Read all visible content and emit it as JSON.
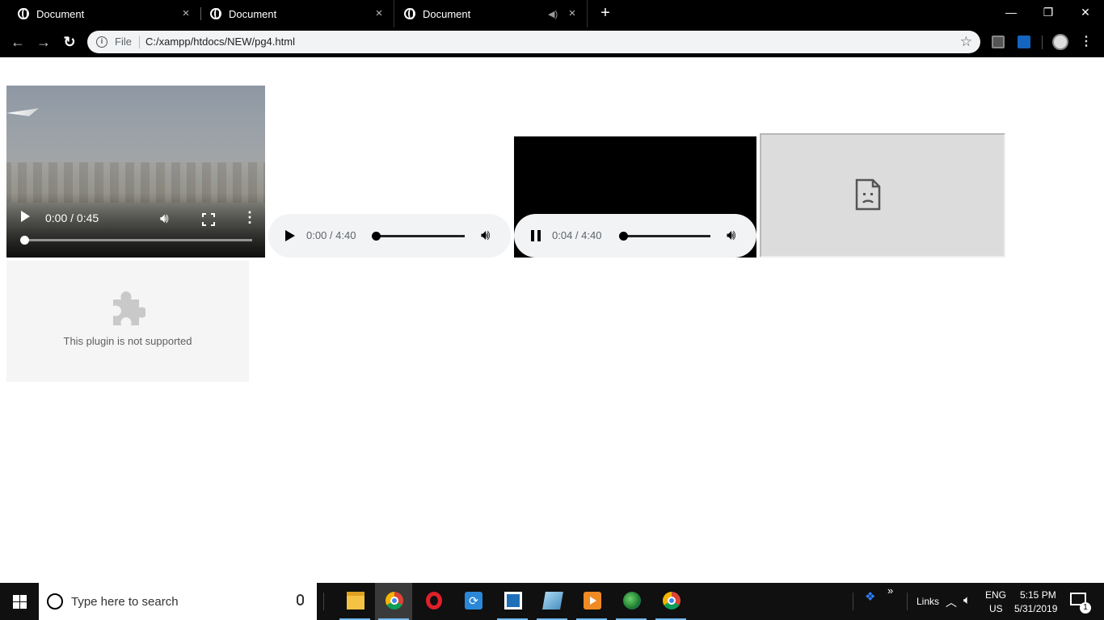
{
  "browser": {
    "tabs": [
      {
        "title": "Document",
        "active": false
      },
      {
        "title": "Document",
        "active": false
      },
      {
        "title": "Document",
        "active": true,
        "audio": true
      }
    ],
    "tab_close_glyph": "×",
    "new_tab_glyph": "+",
    "window_controls": {
      "minimize": "—",
      "restore": "❐",
      "close": "✕"
    },
    "nav": {
      "back": "←",
      "forward": "→",
      "reload": "↻"
    },
    "omnibox": {
      "scheme_label": "File",
      "url": "C:/xampp/htdocs/NEW/pg4.html",
      "star": "☆"
    }
  },
  "page": {
    "video": {
      "time": "0:00 / 0:45",
      "progress": 0.0,
      "playing": false
    },
    "audio_players": [
      {
        "time": "0:00 / 4:40",
        "playing": false,
        "progress": 0.0
      },
      {
        "time": "0:04 / 4:40",
        "playing": true,
        "progress": 0.014
      }
    ],
    "iframe": {
      "state": "sad-page-icon"
    },
    "plugin": {
      "message": "This plugin is not supported",
      "icon": "puzzle-piece-icon"
    }
  },
  "taskbar": {
    "search_placeholder": "Type here to search",
    "apps": [
      "file-explorer",
      "chrome",
      "opera",
      "sync-app",
      "sublime-like",
      "notepad-like",
      "media-player",
      "idm",
      "chrome"
    ],
    "tray": {
      "links_label": "Links",
      "chevron": "»",
      "language": "ENG",
      "region": "US",
      "time": "5:15 PM",
      "date": "5/31/2019",
      "notifications": "1"
    }
  },
  "colors": {
    "accent": "#1a73e8",
    "taskbar": "#101010",
    "tabstrip": "#000000",
    "omnibox": "#f1f3f4"
  }
}
